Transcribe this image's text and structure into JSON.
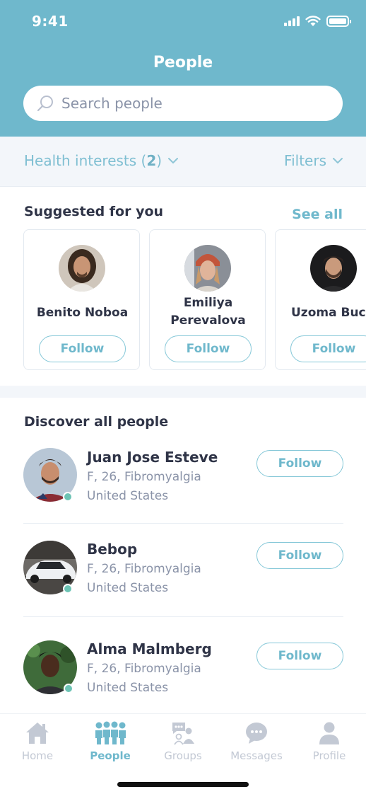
{
  "status_bar": {
    "time": "9:41"
  },
  "header": {
    "title": "People"
  },
  "search": {
    "placeholder": "Search people",
    "value": ""
  },
  "filters": {
    "health_label": "Health interests (",
    "health_count": "2",
    "health_close": ")",
    "filters_label": "Filters"
  },
  "suggested": {
    "title": "Suggested for you",
    "see_all": "See  all",
    "people": [
      {
        "name": "Benito Noboa",
        "follow": "Follow"
      },
      {
        "name_line1": "Emiliya",
        "name_line2": "Perevalova",
        "follow": "Follow"
      },
      {
        "name": "Uzoma Buc",
        "follow": "Follow"
      }
    ]
  },
  "discover": {
    "title": "Discover all people",
    "people": [
      {
        "name": "Juan Jose Esteve",
        "details": "F, 26, Fibromyalgia",
        "location": "United States",
        "follow": "Follow"
      },
      {
        "name": "Bebop",
        "details": "F, 26, Fibromyalgia",
        "location": "United States",
        "follow": "Follow"
      },
      {
        "name": "Alma Malmberg",
        "details": "F, 26, Fibromyalgia",
        "location": "United States",
        "follow": "Follow"
      }
    ]
  },
  "tabs": [
    {
      "label": "Home",
      "icon": "home-icon",
      "active": false
    },
    {
      "label": "People",
      "icon": "people-icon",
      "active": true
    },
    {
      "label": "Groups",
      "icon": "groups-icon",
      "active": false
    },
    {
      "label": "Messages",
      "icon": "messages-icon",
      "active": false
    },
    {
      "label": "Profile",
      "icon": "profile-icon",
      "active": false
    }
  ],
  "colors": {
    "header": "#6fb8cc",
    "accent": "#6fb8cc",
    "online": "#6cc3b4",
    "muted": "#8a93a8",
    "inactive_tab": "#c3c9d4"
  }
}
